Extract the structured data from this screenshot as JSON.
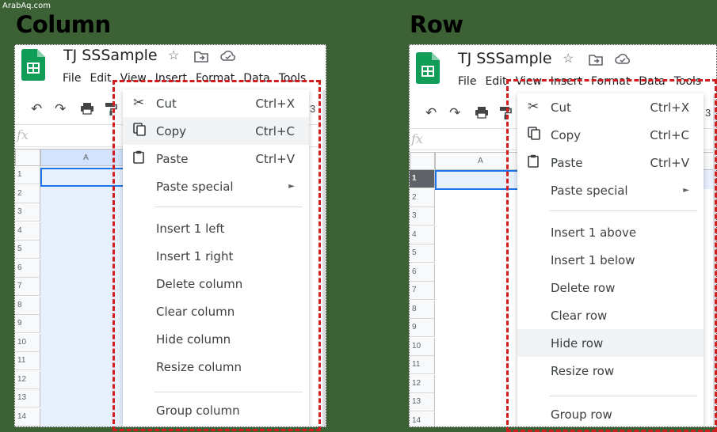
{
  "watermark": "ArabAq.com",
  "left": {
    "heading": "Column",
    "doc_title": "TJ SSSample",
    "menus": [
      "File",
      "Edit",
      "View",
      "Insert",
      "Format",
      "Data",
      "Tools"
    ],
    "toolbar_tail": "3",
    "fx": "fx",
    "column_header": "A",
    "rows": [
      "1",
      "2",
      "3",
      "4",
      "5",
      "6",
      "7",
      "8",
      "9",
      "10",
      "11",
      "12",
      "13",
      "14"
    ],
    "context_menu": {
      "cut": {
        "label": "Cut",
        "shortcut": "Ctrl+X"
      },
      "copy": {
        "label": "Copy",
        "shortcut": "Ctrl+C"
      },
      "paste": {
        "label": "Paste",
        "shortcut": "Ctrl+V"
      },
      "paste_special": {
        "label": "Paste special",
        "arrow": "►"
      },
      "items": [
        "Insert 1 left",
        "Insert 1 right",
        "Delete column",
        "Clear column",
        "Hide column",
        "Resize column"
      ],
      "group": "Group column"
    }
  },
  "right": {
    "heading": "Row",
    "doc_title": "TJ SSSample",
    "menus": [
      "File",
      "Edit",
      "View",
      "Insert",
      "Format",
      "Data",
      "Tools"
    ],
    "toolbar_tail": "3",
    "fx": "fx",
    "column_header": "A",
    "rows": [
      "1",
      "2",
      "3",
      "4",
      "5",
      "6",
      "7",
      "8",
      "9",
      "10",
      "11",
      "12",
      "13",
      "14"
    ],
    "context_menu": {
      "cut": {
        "label": "Cut",
        "shortcut": "Ctrl+X"
      },
      "copy": {
        "label": "Copy",
        "shortcut": "Ctrl+C"
      },
      "paste": {
        "label": "Paste",
        "shortcut": "Ctrl+V"
      },
      "paste_special": {
        "label": "Paste special",
        "arrow": "►"
      },
      "items": [
        "Insert 1 above",
        "Insert 1 below",
        "Delete row",
        "Clear row",
        "Hide row",
        "Resize row"
      ],
      "group": "Group row"
    }
  },
  "icons": {
    "star": "star-icon",
    "folder": "move-folder-icon",
    "cloud": "cloud-status-icon",
    "undo": "undo-icon",
    "redo": "redo-icon",
    "print": "print-icon",
    "paint": "paint-format-icon",
    "cut": "scissors-icon",
    "copy": "copy-icon",
    "paste": "clipboard-icon"
  },
  "colors": {
    "sheets_green": "#0f9d58",
    "selection_blue": "#1a73e8",
    "selection_fill": "#e8f0fe",
    "highlight_box": "#d01e1e",
    "background": "#3b6134"
  }
}
